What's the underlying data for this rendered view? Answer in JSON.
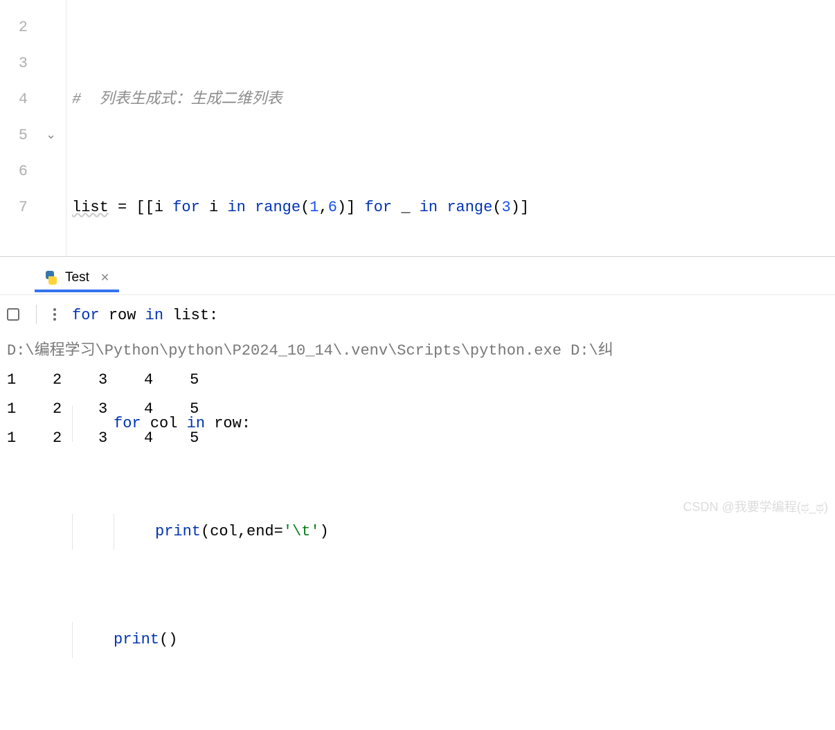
{
  "editor": {
    "line_numbers": [
      "2",
      "3",
      "4",
      "5",
      "6",
      "7"
    ],
    "lines": {
      "l2": {
        "comment": "#  列表生成式：生成二维列表"
      },
      "l3": {
        "var": "list",
        "eq": " = [[",
        "i1": "i",
        "for1": " for ",
        "i2": "i",
        "in1": " in ",
        "range1": "range",
        "p1": "(",
        "n1": "1",
        "comma": ",",
        "n6": "6",
        "p2": ")] ",
        "for2": "for ",
        "under": "_",
        "in2": " in ",
        "range2": "range",
        "p3": "(",
        "n3": "3",
        "p4": ")]"
      },
      "l4": {
        "for": "for ",
        "row": "row",
        "in": " in ",
        "list": "list",
        "colon": ":"
      },
      "l5": {
        "for": "for ",
        "col": "col",
        "in": " in ",
        "row": "row",
        "colon": ":"
      },
      "l6": {
        "print": "print",
        "p1": "(",
        "col": "col",
        "comma": ",",
        "end": "end",
        "eq": "=",
        "str": "'\\t'",
        "p2": ")"
      },
      "l7": {
        "print": "print",
        "parens": "()"
      }
    }
  },
  "terminal": {
    "tab_name": "Test",
    "command": "D:\\编程学习\\Python\\python\\P2024_10_14\\.venv\\Scripts\\python.exe D:\\纠",
    "output_rows": [
      [
        "1",
        "2",
        "3",
        "4",
        "5"
      ],
      [
        "1",
        "2",
        "3",
        "4",
        "5"
      ],
      [
        "1",
        "2",
        "3",
        "4",
        "5"
      ]
    ]
  },
  "watermark": "CSDN @我要学编程(ಥ_ಥ)"
}
